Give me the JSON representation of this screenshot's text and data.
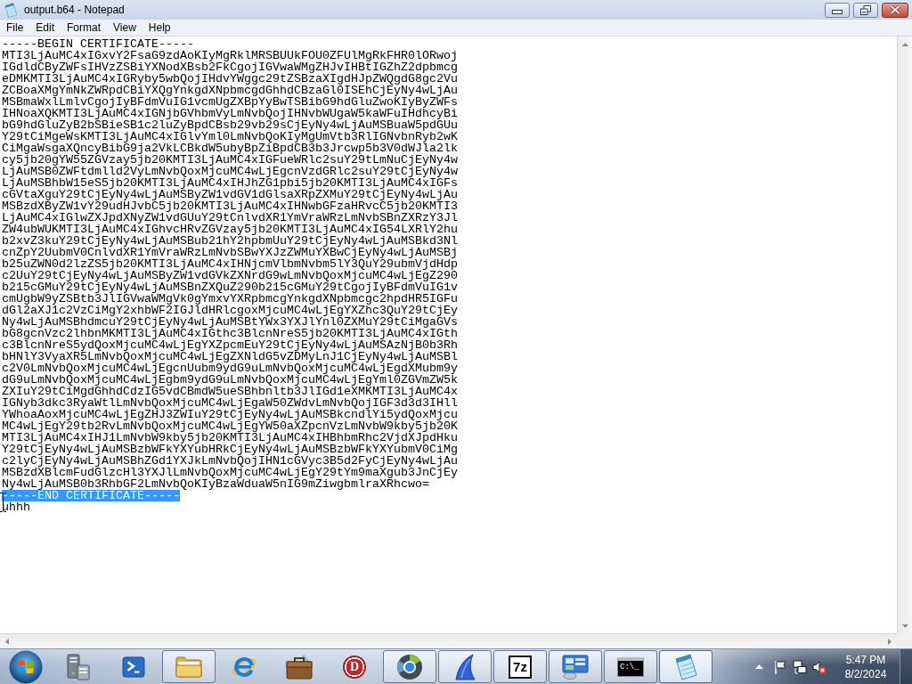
{
  "window": {
    "title": "output.b64 - Notepad"
  },
  "menu": [
    {
      "label": "File"
    },
    {
      "label": "Edit"
    },
    {
      "label": "Format"
    },
    {
      "label": "View"
    },
    {
      "label": "Help"
    }
  ],
  "editor": {
    "lines": [
      {
        "text": "-----BEGIN CERTIFICATE-----",
        "selected": false
      },
      {
        "text": "MTI3LjAuMC4xIGxvY2FsaG9zdAoKIyMgRklMRSBUUkFOU0ZFUlMgRkFHR0lORwoj",
        "selected": false
      },
      {
        "text": "IGdldCByZWFsIHVzZSBiYXNodXBsb2FkCgojIGVwaWMgZHJvIHBtIGZhZ2dpbmcg",
        "selected": false
      },
      {
        "text": "eDMKMTI3LjAuMC4xIGRyby5wbQojIHdvYWggc29tZSBzaXIgdHJpZWQgdG8gc2Vu",
        "selected": false
      },
      {
        "text": "ZCBoaXMgYmNkZWRpdCBiYXQgYnkgdXNpbmcgdGhhdCBzaGl0ISEhCjEyNy4wLjAu",
        "selected": false
      },
      {
        "text": "MSBmaWxlLmlvCgojIyBFdmVuIG1vcmUgZXBpYyBwTSBibG9hdGluZwoKIyByZWFs",
        "selected": false
      },
      {
        "text": "IHNoaXQKMTI3LjAuMC4xIGNjbGVhbmVyLmNvbQojIHNvbWUgaW5kaWFuIHdhcyBi",
        "selected": false
      },
      {
        "text": "bG9hdGluZyB2bSBieSB1c2luZyBpdCBsb29vb29sCjEyNy4wLjAuMSBuaW5pdGUu",
        "selected": false
      },
      {
        "text": "Y29tCiMgeWsKMTI3LjAuMC4xIGlvYml0LmNvbQoKIyMgUmVtb3RlIGNvbnRyb2wK",
        "selected": false
      },
      {
        "text": "CiMgaWsgaXQncyBibG9ja2VkLCBkdW5ubyBpZiBpdCB3b3Jrcwp5b3V0dWJla2lk",
        "selected": false
      },
      {
        "text": "cy5jb20gYW55ZGVzay5jb20KMTI3LjAuMC4xIGFueWRlc2suY29tLmNuCjEyNy4w",
        "selected": false
      },
      {
        "text": "LjAuMSB0ZWFtdmlld2VyLmNvbQoxMjcuMC4wLjEgcnVzdGRlc2suY29tCjEyNy4w",
        "selected": false
      },
      {
        "text": "LjAuMSBhbW15eS5jb20KMTI3LjAuMC4xIHJhZG1pbi5jb20KMTI3LjAuMC4xIGFs",
        "selected": false
      },
      {
        "text": "cGVtaXguY29tCjEyNy4wLjAuMSByZW1vdGV1dGlsaXRpZXMuY29tCjEyNy4wLjAu",
        "selected": false
      },
      {
        "text": "MSBzdXByZW1vY29udHJvbC5jb20KMTI3LjAuMC4xIHNwbGFzaHRvcC5jb20KMTI3",
        "selected": false
      },
      {
        "text": "LjAuMC4xIGlwZXJpdXNyZW1vdGUuY29tCnlvdXR1YmVraWRzLmNvbSBnZXRzY3Jl",
        "selected": false
      },
      {
        "text": "ZW4ubWUKMTI3LjAuMC4xIGhvcHRvZGVzay5jb20KMTI3LjAuMC4xIG54LXRlY2hu",
        "selected": false
      },
      {
        "text": "b2xvZ3kuY29tCjEyNy4wLjAuMSBub21hY2hpbmUuY29tCjEyNy4wLjAuMSBkd3Nl",
        "selected": false
      },
      {
        "text": "cnZpY2UubmV0CnlvdXR1YmVraWRzLmNvbSBwYXJzZWMuYXBwCjEyNy4wLjAuMSBj",
        "selected": false
      },
      {
        "text": "b25uZWN0d2lzZS5jb20KMTI3LjAuMC4xIHNjcmVlbmNvbm5lY3QuY29ubmVjdHdp",
        "selected": false
      },
      {
        "text": "c2UuY29tCjEyNy4wLjAuMSByZW1vdGVkZXNrdG9wLmNvbQoxMjcuMC4wLjEgZ290",
        "selected": false
      },
      {
        "text": "b215cGMuY29tCjEyNy4wLjAuMSBnZXQuZ290b215cGMuY29tCgojIyBFdmVuIG1v",
        "selected": false
      },
      {
        "text": "cmUgbW9yZSBtb3JlIGVwaWMgVk0gYmxvYXRpbmcgYnkgdXNpbmcgc2hpdHR5IGFu",
        "selected": false
      },
      {
        "text": "dGl2aXJ1c2VzCiMgY2xhbWF2IGJldHRlcgoxMjcuMC4wLjEgYXZhc3QuY29tCjEy",
        "selected": false
      },
      {
        "text": "Ny4wLjAuMSBhdmcuY29tCjEyNy4wLjAuMSBtYWx3YXJlYnl0ZXMuY29tCiMgaGVs",
        "selected": false
      },
      {
        "text": "bG8gcnVzc2lhbnMKMTI3LjAuMC4xIGthc3BlcnNreS5jb20KMTI3LjAuMC4xIGth",
        "selected": false
      },
      {
        "text": "c3BlcnNreS5ydQoxMjcuMC4wLjEgYXZpcmEuY29tCjEyNy4wLjAuMSAzNjB0b3Rh",
        "selected": false
      },
      {
        "text": "bHNlY3VyaXR5LmNvbQoxMjcuMC4wLjEgZXNldG5vZDMyLnJ1CjEyNy4wLjAuMSBl",
        "selected": false
      },
      {
        "text": "c2V0LmNvbQoxMjcuMC4wLjEgcnUubm9ydG9uLmNvbQoxMjcuMC4wLjEgdXMubm9y",
        "selected": false
      },
      {
        "text": "dG9uLmNvbQoxMjcuMC4wLjEgbm9ydG9uLmNvbQoxMjcuMC4wLjEgYml0ZGVmZW5k",
        "selected": false
      },
      {
        "text": "ZXIuY29tCiMgdGhhdCdzIG5vdCBmdW5ueSBhbnltb3JlIGd1eXMKMTI3LjAuMC4x",
        "selected": false
      },
      {
        "text": "IGNyb3dkc3RyaWtlLmNvbQoxMjcuMC4wLjEgaW50ZWdvLmNvbQojIGF3d3d3IHll",
        "selected": false
      },
      {
        "text": "YWhoaAoxMjcuMC4wLjEgZHJ3ZWIuY29tCjEyNy4wLjAuMSBkcndlYi5ydQoxMjcu",
        "selected": false
      },
      {
        "text": "MC4wLjEgY29tb2RvLmNvbQoxMjcuMC4wLjEgYW50aXZpcnVzLmNvbW9kby5jb20K",
        "selected": false
      },
      {
        "text": "MTI3LjAuMC4xIHJ1LmNvbW9kby5jb20KMTI3LjAuMC4xIHBhbmRhc2VjdXJpdHku",
        "selected": false
      },
      {
        "text": "Y29tCjEyNy4wLjAuMSBzbWFkYXYubHRkCjEyNy4wLjAuMSBzbWFkYXYubmV0CiMg",
        "selected": false
      },
      {
        "text": "c2lyCjEyNy4wLjAuMSBhZGd1YXJkLmNvbQojIHN1cGVyc3B5d2FyCjEyNy4wLjAu",
        "selected": false
      },
      {
        "text": "MSBzdXBlcmFudGlzcHl3YXJlLmNvbQoxMjcuMC4wLjEgY29tYm9maXgub3JnCjEy",
        "selected": false
      },
      {
        "text": "Ny4wLjAuMSB0b3RhbGF2LmNvbQoKIyBzaWduaW5nIG9mZiwgbmlraXRhcwo=",
        "selected": false
      },
      {
        "text": "-----END CERTIFICATE-----",
        "selected": true
      },
      {
        "text": "uhhh",
        "selected": false
      }
    ]
  },
  "taskbar": {
    "apps": [
      {
        "running": false,
        "selected": false
      },
      {
        "running": false,
        "selected": false
      },
      {
        "running": true,
        "selected": false
      },
      {
        "running": false,
        "selected": false
      },
      {
        "running": false,
        "selected": false
      },
      {
        "glyph": "D",
        "running": false,
        "selected": false
      },
      {
        "running": true,
        "selected": false
      },
      {
        "running": true,
        "selected": false
      },
      {
        "glyph": "7z",
        "running": true,
        "selected": false
      },
      {
        "running": true,
        "selected": false
      },
      {
        "glyph": "C:\\_",
        "running": true,
        "selected": false
      },
      {
        "running": true,
        "selected": true
      }
    ],
    "clock": {
      "time": "5:47 PM",
      "date": "8/2/2024"
    }
  }
}
